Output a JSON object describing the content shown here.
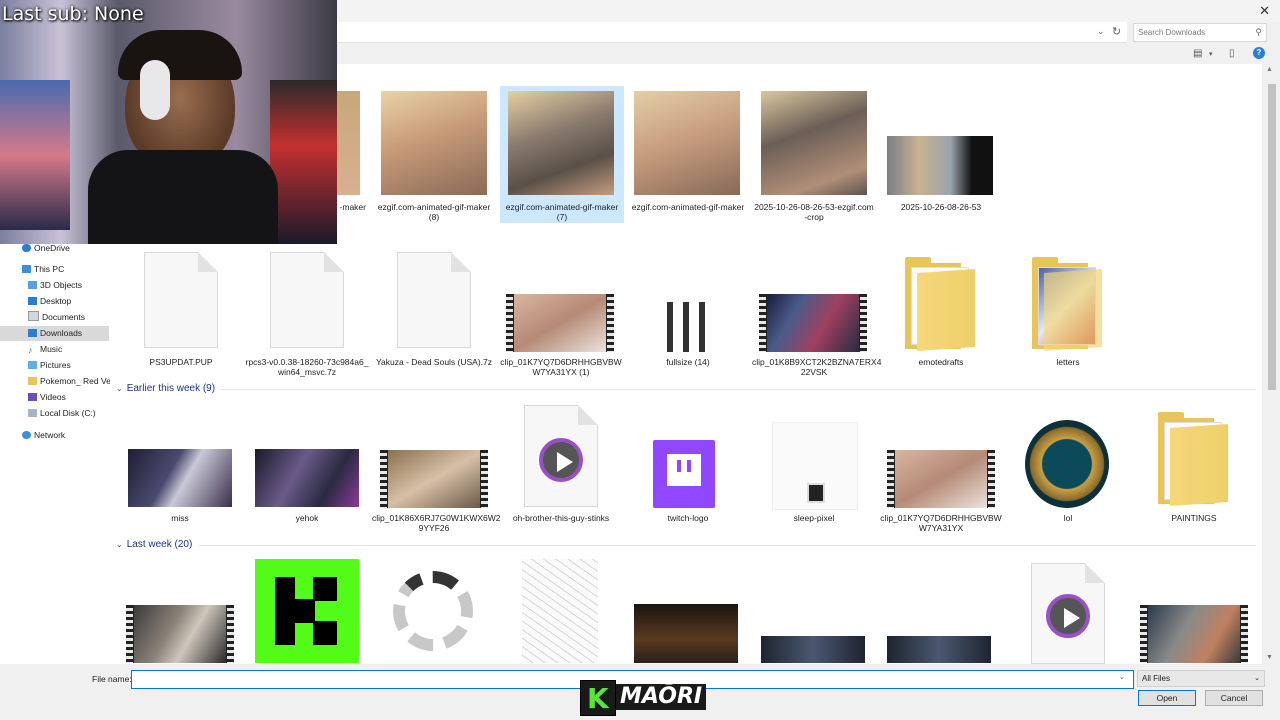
{
  "overlay": {
    "last_sub": "Last sub: None",
    "brand_text": "MAŌRI",
    "brand_letter": "K"
  },
  "titlebar": {
    "close": "✕"
  },
  "search": {
    "placeholder": "Search Downloads"
  },
  "sidebar": {
    "items": [
      {
        "label": "OneDrive",
        "icon": "cloud-icon"
      },
      {
        "label": "This PC",
        "icon": "computer-icon"
      },
      {
        "label": "3D Objects",
        "icon": "cube-icon"
      },
      {
        "label": "Desktop",
        "icon": "desktop-icon"
      },
      {
        "label": "Documents",
        "icon": "document-icon"
      },
      {
        "label": "Downloads",
        "icon": "download-icon",
        "selected": true
      },
      {
        "label": "Music",
        "icon": "music-icon"
      },
      {
        "label": "Pictures",
        "icon": "picture-icon"
      },
      {
        "label": "Pokemon_ Red Vers",
        "icon": "folder-icon"
      },
      {
        "label": "Videos",
        "icon": "video-icon"
      },
      {
        "label": "Local Disk (C:)",
        "icon": "drive-icon"
      },
      {
        "label": "Network",
        "icon": "network-icon"
      }
    ]
  },
  "groups": {
    "earlier": "Earlier this week (9)",
    "last_week": "Last week (20)"
  },
  "today_row1": [
    {
      "label": "-maker"
    },
    {
      "label": "ezgif.com-animated-gif-maker (8)"
    },
    {
      "label": "ezgif.com-animated-gif-maker (7)",
      "selected": true
    },
    {
      "label": "ezgif.com-animated-gif-maker"
    },
    {
      "label": "2025-10-26-08-26-53-ezgif.com -crop"
    },
    {
      "label": "2025-10-26-08-26-53"
    }
  ],
  "today_row2": [
    {
      "label": "PS3UPDAT.PUP"
    },
    {
      "label": "rpcs3-v0.0.38-18260-73c984a6_ win64_msvc.7z"
    },
    {
      "label": "Yakuza - Dead Souls (USA).7z"
    },
    {
      "label": "clip_01K7YQ7D6DRHHGBVBW W7YA31YX (1)"
    },
    {
      "label": "fullsize (14)"
    },
    {
      "label": "clip_01K8B9XCT2K2BZNA7ERX4 22VSK"
    },
    {
      "label": "emotedrafts"
    },
    {
      "label": "letters"
    }
  ],
  "earlier_row": [
    {
      "label": "miss"
    },
    {
      "label": "yehok"
    },
    {
      "label": "clip_01K86X6RJ7G0W1KWX6W2 9YYF26"
    },
    {
      "label": "oh-brother-this-guy-stinks"
    },
    {
      "label": "twitch-logo"
    },
    {
      "label": "sleep-pixel"
    },
    {
      "label": "clip_01K7YQ7D6DRHHGBVBW W7YA31YX"
    },
    {
      "label": "lol"
    },
    {
      "label": "PAINTINGS"
    }
  ],
  "footer": {
    "file_name_label": "File name:",
    "file_name_value": "",
    "file_type": "All Files",
    "open": "Open",
    "cancel": "Cancel"
  },
  "colors": {
    "accent": "#0078d7",
    "group_header": "#1e3287",
    "selected": "#cce8ff",
    "kick_green": "#53fc18"
  }
}
